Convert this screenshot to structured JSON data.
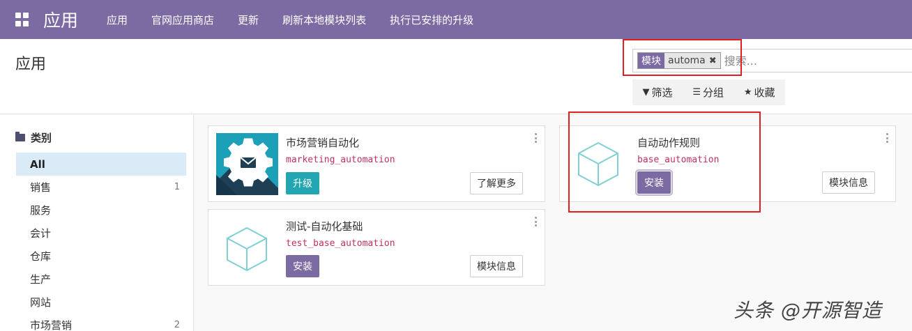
{
  "navbar": {
    "brand": "应用",
    "items": [
      "应用",
      "官网应用商店",
      "更新",
      "刷新本地模块列表",
      "执行已安排的升级"
    ]
  },
  "control_panel": {
    "title": "应用",
    "search": {
      "facet_label": "模块",
      "facet_value": "automa",
      "placeholder": "搜索..."
    },
    "filters": {
      "filter_label": "筛选",
      "group_label": "分组",
      "favorite_label": "收藏"
    }
  },
  "sidebar": {
    "header": "类别",
    "items": [
      {
        "label": "All",
        "count": ""
      },
      {
        "label": "销售",
        "count": "1"
      },
      {
        "label": "服务",
        "count": ""
      },
      {
        "label": "会计",
        "count": ""
      },
      {
        "label": "仓库",
        "count": ""
      },
      {
        "label": "生产",
        "count": ""
      },
      {
        "label": "网站",
        "count": ""
      },
      {
        "label": "市场营销",
        "count": "2"
      }
    ]
  },
  "cards": [
    {
      "title": "市场营销自动化",
      "tech": "marketing_automation",
      "primary": "升级",
      "secondary": "了解更多"
    },
    {
      "title": "自动动作规则",
      "tech": "base_automation",
      "primary": "安装",
      "secondary": "模块信息"
    },
    {
      "title": "测试-自动化基础",
      "tech": "test_base_automation",
      "primary": "安装",
      "secondary": "模块信息"
    }
  ],
  "watermark": "头条 @开源智造",
  "colors": {
    "brand": "#7c6ba3",
    "upgrade": "#21a6b2",
    "tech_name": "#c03060",
    "active_category": "#dbeaf7",
    "highlight": "#e02020"
  }
}
